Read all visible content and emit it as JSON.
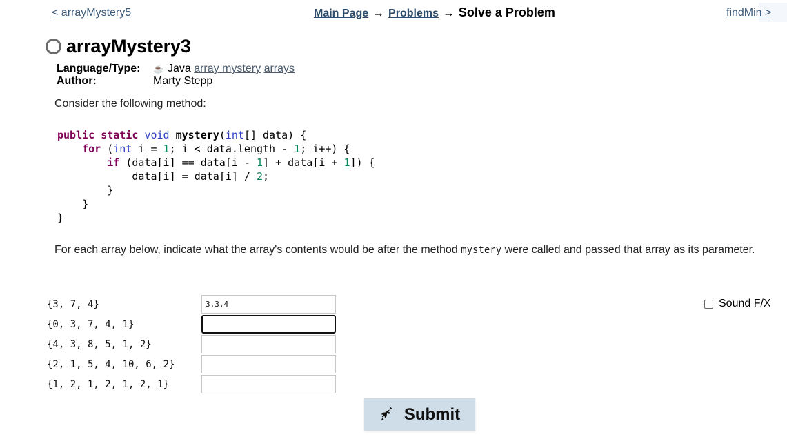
{
  "nav": {
    "prev_label": "< arrayMystery5",
    "next_label": "findMin >",
    "breadcrumbs": [
      {
        "label": "Main Page",
        "link": true
      },
      {
        "label": "Problems",
        "link": true
      },
      {
        "label": "Solve a Problem",
        "link": false
      }
    ],
    "arrow": "→"
  },
  "problem": {
    "title": "arrayMystery3",
    "status_icon": "circle-outline-icon",
    "meta": {
      "language_label": "Language/Type:",
      "language": "Java",
      "language_icon": "java-icon",
      "tags": [
        "array mystery",
        "arrays"
      ],
      "author_label": "Author:",
      "author": "Marty Stepp"
    },
    "intro": "Consider the following method:",
    "code_lines": [
      "public static void mystery(int[] data) {",
      "    for (int i = 1; i < data.length - 1; i++) {",
      "        if (data[i] == data[i - 1] + data[i + 1]) {",
      "            data[i] = data[i] / 2;",
      "        }",
      "    }",
      "}"
    ],
    "instructions_before": "For each array below, indicate what the array's contents would be after the method ",
    "instructions_code": "mystery",
    "instructions_after": " were called and passed that array as its parameter."
  },
  "questions": [
    {
      "prompt": "{3, 7, 4}",
      "answer": "3,3,4",
      "focused": false
    },
    {
      "prompt": "{0, 3, 7, 4, 1}",
      "answer": "",
      "focused": true
    },
    {
      "prompt": "{4, 3, 8, 5, 1, 2}",
      "answer": "",
      "focused": false
    },
    {
      "prompt": "{2, 1, 5, 4, 10, 6, 2}",
      "answer": "",
      "focused": false
    },
    {
      "prompt": "{1, 2, 1, 2, 1, 2, 1}",
      "answer": "",
      "focused": false
    }
  ],
  "sound_fx": {
    "label": "Sound F/X",
    "checked": false
  },
  "submit": {
    "label": "Submit",
    "icon": "rocket-icon"
  },
  "colors": {
    "link": "#2e4d6c",
    "keyword": "#7f0055",
    "type": "#2f3fc4",
    "number": "#098658",
    "submit_bg": "#cfdde9"
  }
}
